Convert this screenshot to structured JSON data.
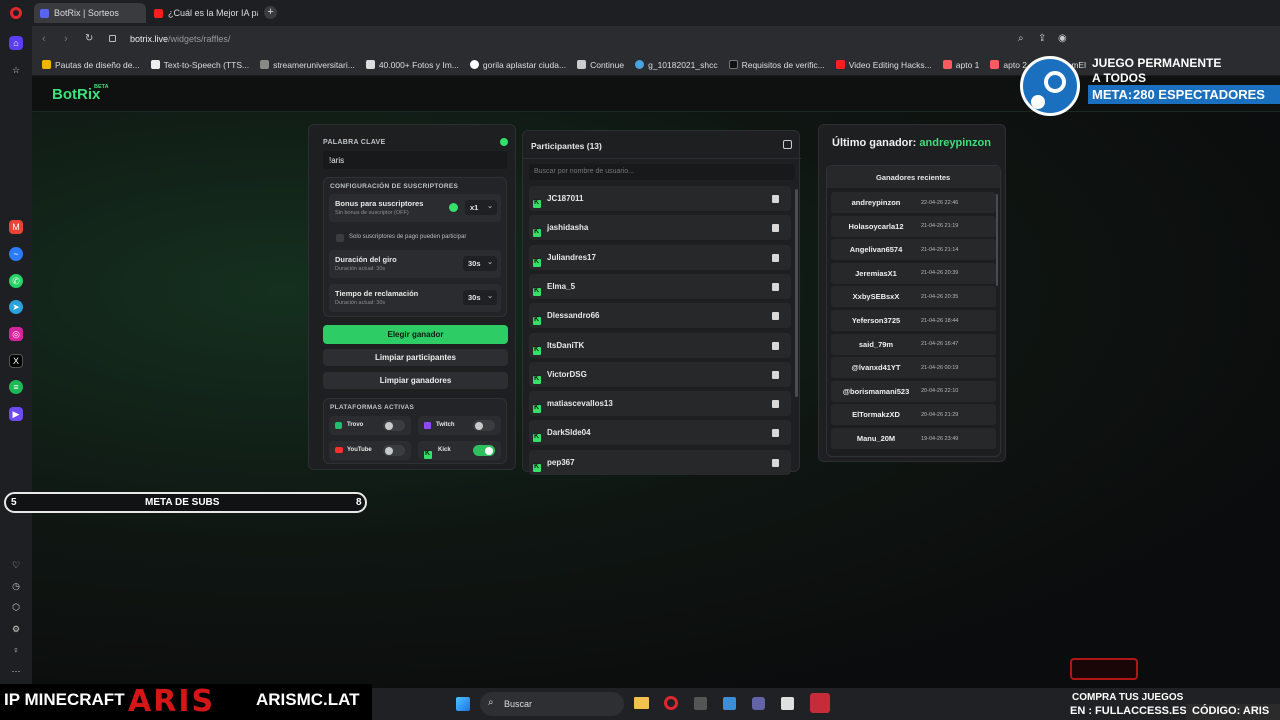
{
  "browser": {
    "tabs": [
      {
        "label": "BotRix | Sorteos",
        "active": true
      },
      {
        "label": "¿Cuál es la Mejor IA para C",
        "active": false
      }
    ],
    "url_host": "botrix.live",
    "url_path": "/widgets/raffles/",
    "bookmarks": [
      "Pautas de diseño de...",
      "Text-to-Speech (TTS...",
      "streameruniversitari...",
      "40.000+ Fotos y Im...",
      "gorila aplastar ciuda...",
      "Continue",
      "g_10182021_shcc",
      "Requisitos de verific...",
      "Video Editing Hacks...",
      "apto 1",
      "apto 2",
      "StreamEl"
    ]
  },
  "app": {
    "logo": "BotRix",
    "logo_badge": "BETA"
  },
  "config": {
    "keyword_label": "PALABRA CLAVE",
    "keyword_value": "!aris",
    "subs_section_title": "CONFIGURACIÓN DE SUSCRIPTORES",
    "bonus_title": "Bonus para suscriptores",
    "bonus_sub": "Sin bonus de suscriptor (OFF)",
    "bonus_value": "x1",
    "subs_only": "Solo suscriptores de pago pueden participar",
    "spin_title": "Duración del giro",
    "spin_sub": "Duración actual: 30s",
    "spin_value": "30s",
    "claim_title": "Tiempo de reclamación",
    "claim_sub": "Duración actual: 30s",
    "claim_value": "30s",
    "btn_pick": "Elegir ganador",
    "btn_clear_participants": "Limpiar participantes",
    "btn_clear_winners": "Limpiar ganadores",
    "platforms_title": "PLATAFORMAS ACTIVAS",
    "platforms": [
      {
        "name": "Trovo",
        "on": false,
        "color": "#1fbf6f"
      },
      {
        "name": "Twitch",
        "on": false,
        "color": "#9146ff"
      },
      {
        "name": "YouTube",
        "on": false,
        "color": "#ff2d2d"
      },
      {
        "name": "Kick",
        "on": true,
        "color": "#35e06a"
      }
    ]
  },
  "participants": {
    "title": "Participantes (13)",
    "search_placeholder": "Buscar por nombre de usuario...",
    "list": [
      "JC187011",
      "jashidasha",
      "Juliandres17",
      "Elma_5",
      "Dlessandro66",
      "ItsDaniTK",
      "VictorDSG",
      "matiascevallos13",
      "DarkSlde04",
      "pep367"
    ]
  },
  "winners": {
    "last_label": "Último ganador:",
    "last_name": "andreypinzon",
    "recent_title": "Ganadores recientes",
    "list": [
      {
        "name": "andreypinzon",
        "date": "22-04-26 22:46"
      },
      {
        "name": "Holasoycarla12",
        "date": "21-04-26 21:19"
      },
      {
        "name": "Angelivan6574",
        "date": "21-04-26 21:14"
      },
      {
        "name": "JeremiasX1",
        "date": "21-04-26 20:39"
      },
      {
        "name": "XxbySEBsxX",
        "date": "21-04-26 20:35"
      },
      {
        "name": "Yeferson3725",
        "date": "21-04-26 18:44"
      },
      {
        "name": "said_79m",
        "date": "21-04-26 16:47"
      },
      {
        "name": "@lvanxd41YT",
        "date": "21-04-26 00:19"
      },
      {
        "name": "@borismamani523",
        "date": "20-04-26 22:10"
      },
      {
        "name": "ElTormakzXD",
        "date": "20-04-26 21:29"
      },
      {
        "name": "Manu_20M",
        "date": "19-04-26 23:49"
      }
    ]
  },
  "overlays": {
    "steam_line1": "JUEGO PERMANENTE",
    "steam_line2": "A TODOS",
    "steam_meta_label": "META:",
    "steam_meta_value": "280 ESPECTADORES",
    "sub_goal_start": "5",
    "sub_goal_label": "META DE SUBS",
    "sub_goal_end": "8",
    "mc_ip_label": "IP MINECRAFT",
    "mc_brand": "ARIS",
    "mc_domain": "ARISMC.LAT",
    "shop_line1": "COMPRA TUS JUEGOS",
    "shop_line2": "EN : FULLACCESS.ES",
    "code": "CÓDIGO: ARIS"
  },
  "taskbar": {
    "search_placeholder": "Buscar"
  }
}
